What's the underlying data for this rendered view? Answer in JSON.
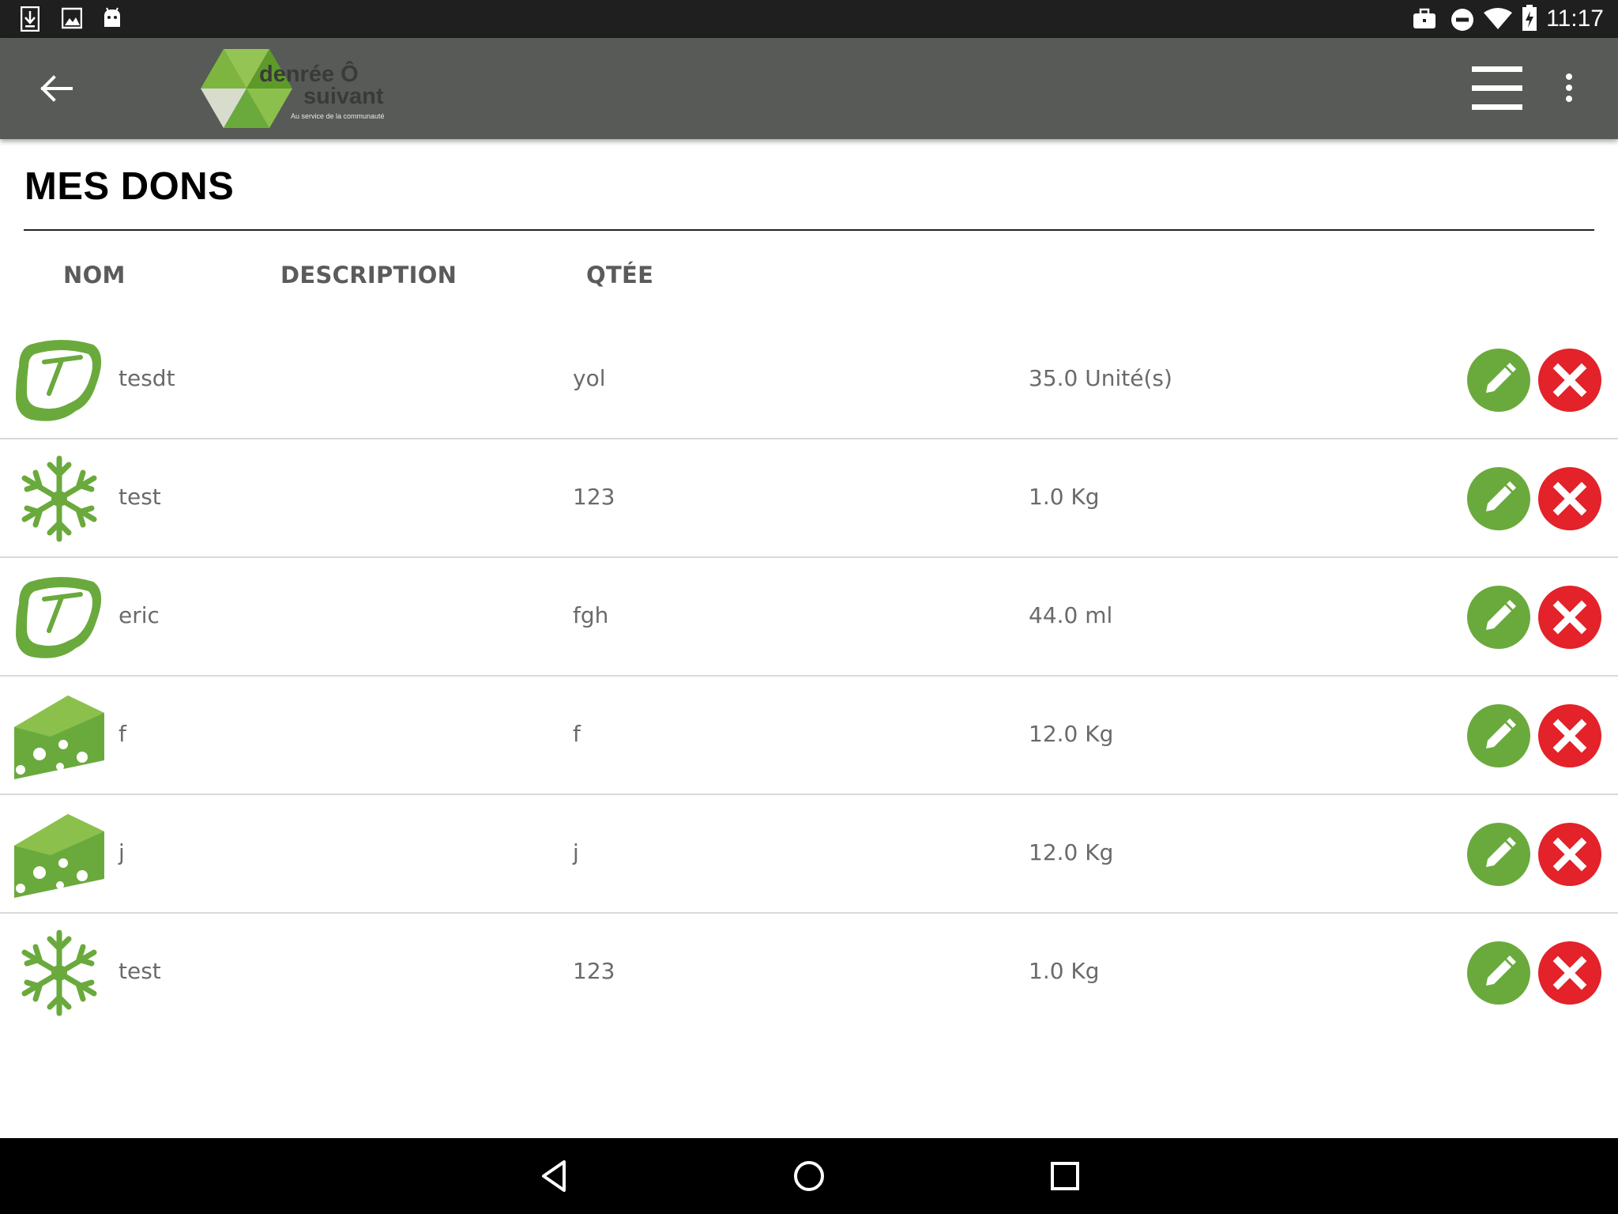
{
  "status_bar": {
    "time": "11:17",
    "left_icons": [
      "download-icon",
      "image-icon",
      "android-icon"
    ],
    "right_icons": [
      "briefcase-icon",
      "do-not-disturb-icon",
      "wifi-icon",
      "battery-charging-icon"
    ]
  },
  "app_bar": {
    "logo": {
      "line1": "denrée Ô",
      "line2": "suivant",
      "tagline": "Au service de la communauté"
    },
    "icons": [
      "back-arrow-icon",
      "hamburger-menu-icon",
      "more-vert-icon"
    ]
  },
  "page": {
    "title": "MES DONS"
  },
  "table": {
    "headers": {
      "name": "NOM",
      "description": "DESCRIPTION",
      "quantity": "QTÉE"
    },
    "rows": [
      {
        "icon": "steak-icon",
        "name": "tesdt",
        "description": "yol",
        "quantity": "35.0 Unité(s)"
      },
      {
        "icon": "snowflake-icon",
        "name": "test",
        "description": "123",
        "quantity": "1.0 Kg"
      },
      {
        "icon": "steak-icon",
        "name": "eric",
        "description": "fgh",
        "quantity": "44.0 ml"
      },
      {
        "icon": "cheese-icon",
        "name": "f",
        "description": "f",
        "quantity": "12.0 Kg"
      },
      {
        "icon": "cheese-icon",
        "name": "j",
        "description": "j",
        "quantity": "12.0 Kg"
      },
      {
        "icon": "snowflake-icon",
        "name": "test",
        "description": "123",
        "quantity": "1.0 Kg"
      }
    ],
    "row_actions": [
      "edit-icon",
      "delete-icon"
    ]
  },
  "colors": {
    "app_bar": "#575a56",
    "brand_green": "#6aaa3d",
    "delete_red": "#e32229",
    "status_bar": "#1f1f1f"
  },
  "nav_bar": {
    "icons": [
      "nav-back-icon",
      "nav-home-icon",
      "nav-recents-icon"
    ]
  }
}
